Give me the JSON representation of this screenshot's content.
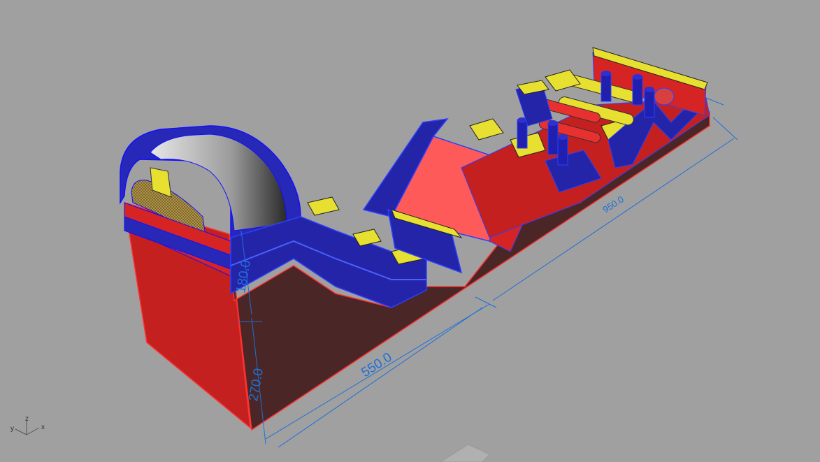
{
  "dimensions": {
    "length_front": "550.0",
    "length_back": "950.0",
    "height_upper": "180.0",
    "height_lower": "270.0"
  },
  "axis_triad": {
    "y": "y",
    "z": "z",
    "x": "x"
  },
  "colors": {
    "background": "#a0a0a0",
    "red": "#e02a2a",
    "blue": "#1f1fb0",
    "yellow": "#e8e030",
    "dark_red": "#4a2626",
    "dimension": "#1e6fd6"
  }
}
